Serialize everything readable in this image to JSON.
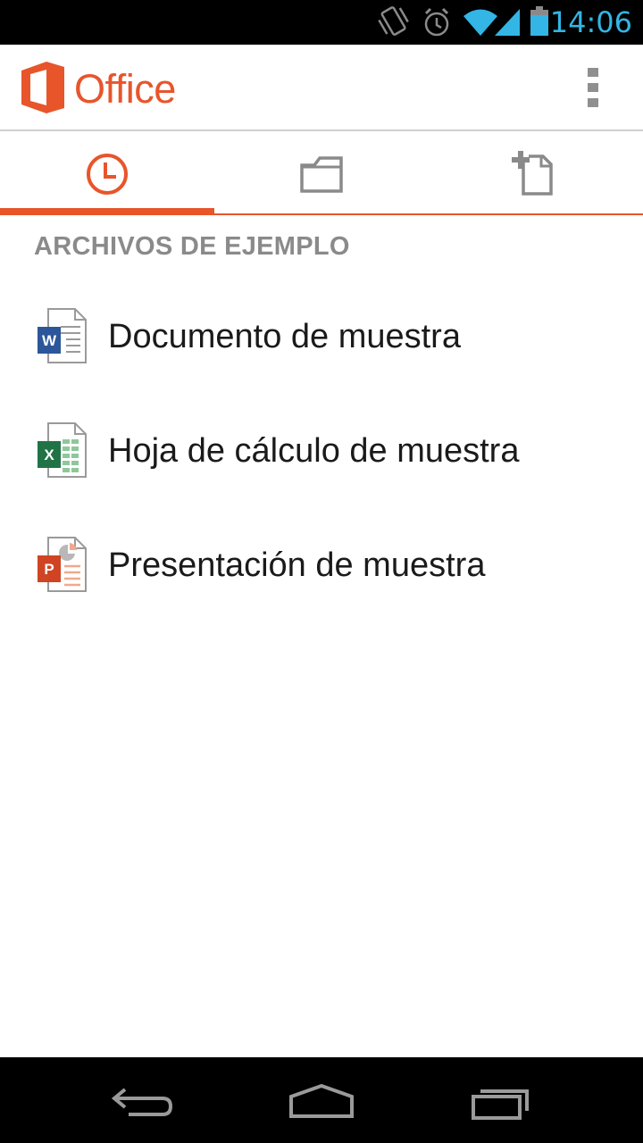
{
  "status_bar": {
    "time": "14:06",
    "icons": [
      "vibrate-icon",
      "alarm-icon",
      "wifi-icon",
      "signal-icon",
      "battery-icon"
    ],
    "time_color": "#33b5e5"
  },
  "app_bar": {
    "title": "Office",
    "logo": "office-logo",
    "menu_icon": "overflow-menu-icon",
    "accent_color": "#e8552b"
  },
  "tabs": [
    {
      "name": "recent",
      "icon": "clock-icon",
      "selected": true
    },
    {
      "name": "open",
      "icon": "folder-icon",
      "selected": false
    },
    {
      "name": "new",
      "icon": "new-document-icon",
      "selected": false
    }
  ],
  "section": {
    "title": "ARCHIVOS DE EJEMPLO"
  },
  "files": [
    {
      "label": "Documento de muestra",
      "icon": "word-file-icon",
      "color": "#2b579a"
    },
    {
      "label": "Hoja de cálculo de muestra",
      "icon": "excel-file-icon",
      "color": "#217346"
    },
    {
      "label": "Presentación de muestra",
      "icon": "powerpoint-file-icon",
      "color": "#d04423"
    }
  ],
  "nav_bar": {
    "buttons": [
      "back-icon",
      "home-icon",
      "recent-apps-icon"
    ]
  }
}
